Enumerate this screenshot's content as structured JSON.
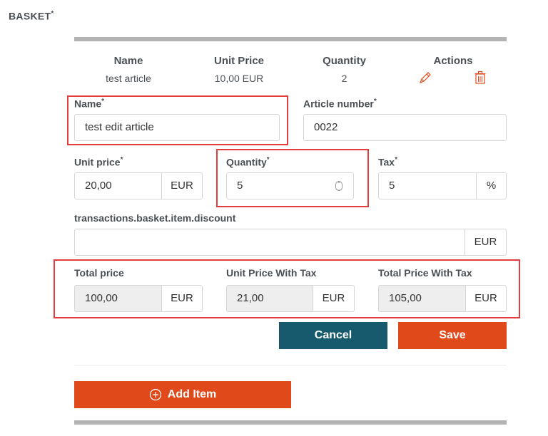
{
  "page": {
    "title": "BASKET",
    "required_mark": "*"
  },
  "table": {
    "headers": {
      "name": "Name",
      "unit_price": "Unit Price",
      "quantity": "Quantity",
      "actions": "Actions"
    },
    "row": {
      "name": "test article",
      "unit_price": "10,00 EUR",
      "quantity": "2"
    },
    "icons": {
      "edit": "pencil-icon",
      "delete": "trash-icon"
    }
  },
  "form": {
    "name": {
      "label": "Name",
      "value": "test edit article"
    },
    "article_number": {
      "label": "Article number",
      "value": "0022"
    },
    "unit_price": {
      "label": "Unit price",
      "value": "20,00",
      "unit": "EUR"
    },
    "quantity": {
      "label": "Quantity",
      "value": "5"
    },
    "tax": {
      "label": "Tax",
      "value": "5",
      "unit": "%"
    },
    "discount": {
      "label": "transactions.basket.item.discount",
      "value": "",
      "unit": "EUR"
    },
    "total_price": {
      "label": "Total price",
      "value": "100,00",
      "unit": "EUR"
    },
    "unit_price_with_tax": {
      "label": "Unit Price With Tax",
      "value": "21,00",
      "unit": "EUR"
    },
    "total_price_with_tax": {
      "label": "Total Price With Tax",
      "value": "105,00",
      "unit": "EUR"
    }
  },
  "buttons": {
    "cancel": "Cancel",
    "save": "Save",
    "add_item": "Add Item"
  },
  "colors": {
    "accent": "#e04a1b",
    "cancel": "#175a6e",
    "highlight": "#e23c3c"
  }
}
